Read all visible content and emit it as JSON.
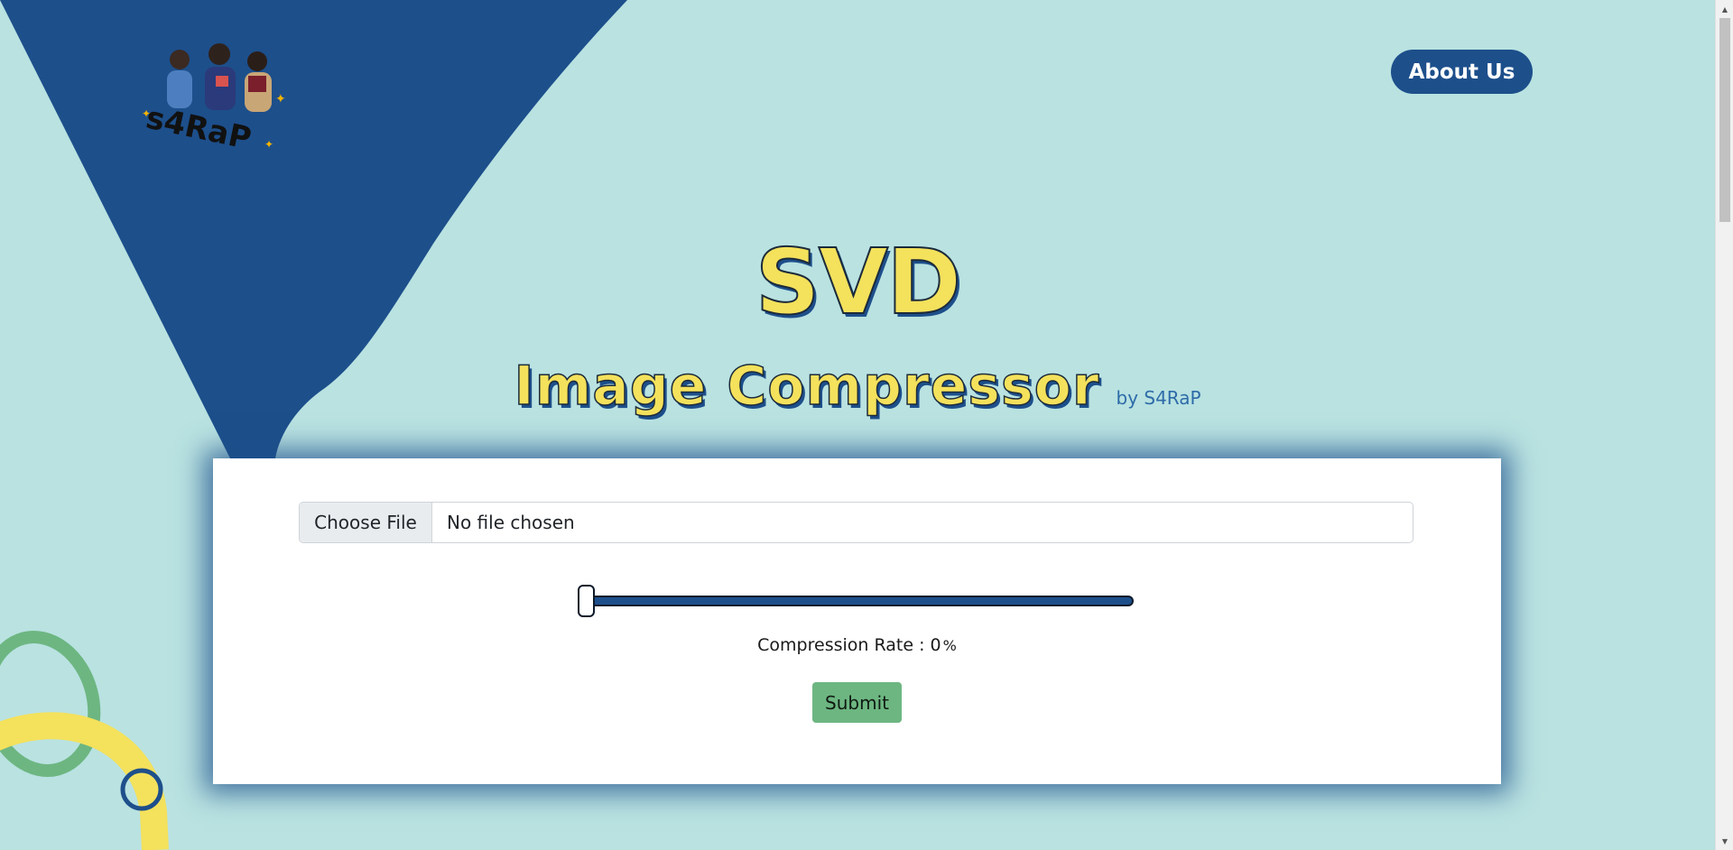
{
  "header": {
    "about_label": "About Us",
    "logo_text": "s4RaP"
  },
  "hero": {
    "title": "SVD",
    "subtitle": "Image Compressor",
    "byline": "by S4RaP"
  },
  "form": {
    "file_button_label": "Choose File",
    "file_status": "No file chosen",
    "compression_label": "Compression Rate : ",
    "compression_value": 0,
    "compression_unit": "%",
    "slider_fraction": 0,
    "submit_label": "Submit"
  },
  "colors": {
    "background": "#b9e2e1",
    "primary_blue": "#1d4f8b",
    "title_yellow": "#f4e15c",
    "submit_green": "#6db681",
    "ring_green": "#6db681",
    "ring_yellow": "#f4e15c"
  },
  "icons": {
    "scroll_up": "triangle-up-icon",
    "scroll_down": "triangle-down-icon"
  }
}
